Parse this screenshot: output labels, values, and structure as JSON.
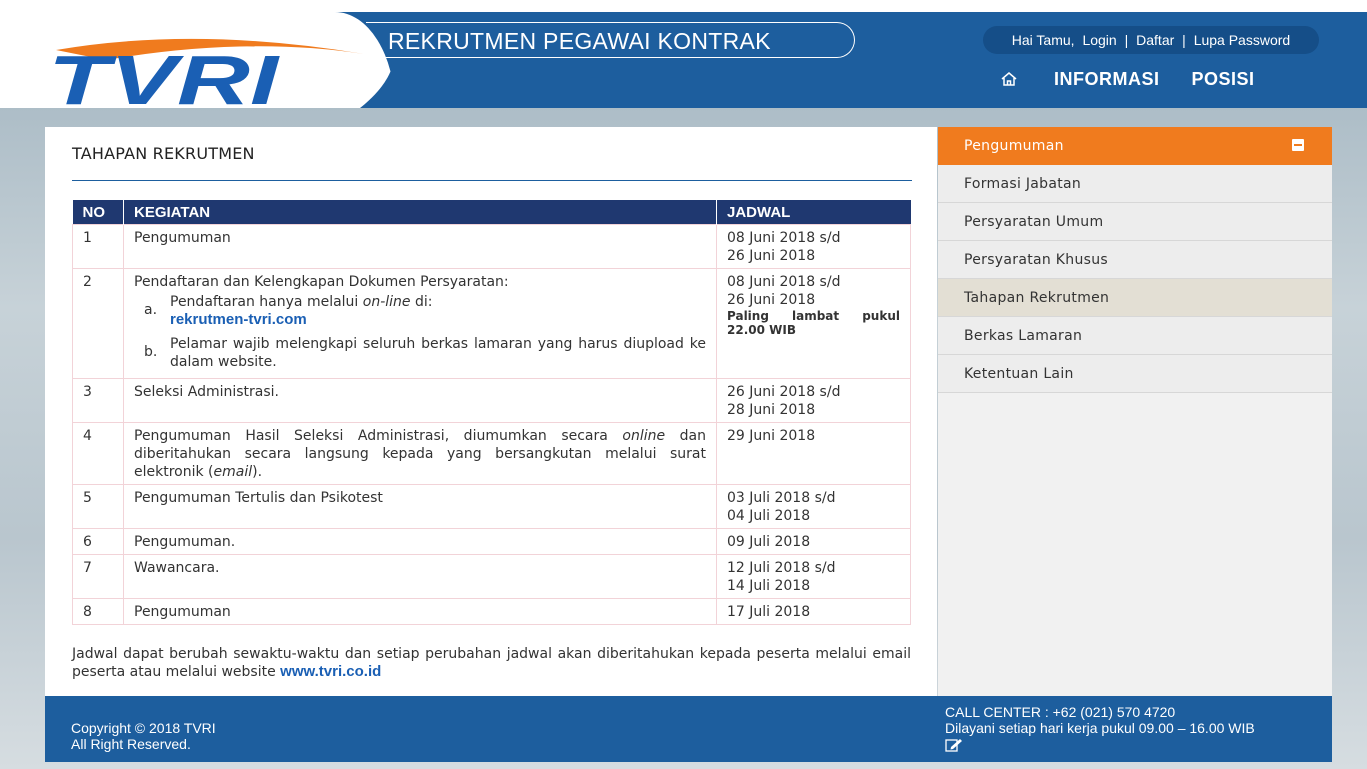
{
  "header": {
    "logo_text": "TVRI",
    "site_title": "REKRUTMEN PEGAWAI KONTRAK",
    "auth": {
      "greeting": "Hai Tamu,",
      "login": "Login",
      "sep": "|",
      "register": "Daftar",
      "forgot": "Lupa Password"
    },
    "nav": [
      {
        "label": "INFORMASI"
      },
      {
        "label": "POSISI"
      }
    ],
    "home_icon": "home-icon"
  },
  "main": {
    "title": "TAHAPAN REKRUTMEN",
    "table": {
      "headers": [
        "NO",
        "KEGIATAN",
        "JADWAL"
      ],
      "rows": [
        {
          "no": "1",
          "kegiatan": "Pengumuman",
          "jadwal": [
            "08 Juni 2018 s/d",
            "26 Juni 2018"
          ]
        },
        {
          "no": "2",
          "kegiatan": "Pendaftaran dan Kelengkapan Dokumen Persyaratan:",
          "sub": [
            {
              "letter": "a.",
              "text_pre": "Pendaftaran hanya melalui ",
              "text_em": "on-line",
              "text_post": " di:",
              "link": "rekrutmen-tvri.com"
            },
            {
              "letter": "b.",
              "text": "Pelamar wajib melengkapi seluruh berkas lamaran yang harus diupload ke dalam website."
            }
          ],
          "jadwal": [
            "08 Juni 2018 s/d",
            "26 Juni 2018"
          ],
          "jadwal_note": "Paling lambat pukul 22.00 WIB"
        },
        {
          "no": "3",
          "kegiatan": "Seleksi Administrasi.",
          "jadwal": [
            "26 Juni 2018 s/d",
            "28 Juni 2018"
          ]
        },
        {
          "no": "4",
          "kegiatan_pre": "Pengumuman Hasil Seleksi Administrasi, diumumkan secara ",
          "kegiatan_em1": "online",
          "kegiatan_mid": " dan diberitahukan secara langsung kepada yang bersangkutan melalui surat elektronik (",
          "kegiatan_em2": "email",
          "kegiatan_post": ").",
          "jadwal": [
            "29 Juni 2018"
          ]
        },
        {
          "no": "5",
          "kegiatan": "Pengumuman Tertulis dan Psikotest",
          "jadwal": [
            "03 Juli 2018 s/d",
            "04 Juli 2018"
          ]
        },
        {
          "no": "6",
          "kegiatan": "Pengumuman.",
          "jadwal": [
            "09 Juli 2018"
          ]
        },
        {
          "no": "7",
          "kegiatan": "Wawancara.",
          "jadwal": [
            "12 Juli 2018 s/d",
            "14 Juli 2018"
          ]
        },
        {
          "no": "8",
          "kegiatan": "Pengumuman",
          "jadwal": [
            "17 Juli 2018"
          ]
        }
      ]
    },
    "note_text": "Jadwal dapat berubah sewaktu-waktu dan setiap perubahan jadwal akan diberitahukan kepada peserta melalui email peserta atau melalui website ",
    "note_link": "www.tvri.co.id"
  },
  "sidebar": {
    "header": "Pengumuman",
    "items": [
      {
        "label": "Formasi Jabatan"
      },
      {
        "label": "Persyaratan Umum"
      },
      {
        "label": "Persyaratan Khusus"
      },
      {
        "label": "Tahapan Rekrutmen",
        "active": true
      },
      {
        "label": "Berkas Lamaran"
      },
      {
        "label": "Ketentuan Lain"
      }
    ]
  },
  "footer": {
    "copyright": "Copyright © 2018 TVRI",
    "rights": "All Right Reserved.",
    "call_center": "CALL CENTER : +62 (021) 570 4720",
    "hours": "Dilayani setiap hari kerja pukul 09.00 – 16.00 WIB"
  },
  "colors": {
    "brand_blue": "#1d5e9e",
    "table_header": "#1f3870",
    "accent_orange": "#f07b1e",
    "link": "#1a5fb4"
  }
}
